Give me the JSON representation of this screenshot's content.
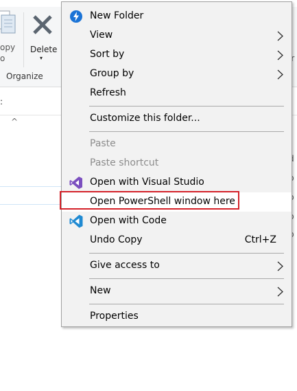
{
  "ribbon": {
    "copy_label_top": "opy",
    "copy_label_bottom": "o",
    "delete_label": "Delete",
    "delete_caret": "▾",
    "organize_label": "Organize"
  },
  "background": {
    "addr_glyph": ":",
    "sort_chevron": "^",
    "right_fragments": [
      "ir",
      "d",
      "p",
      "p",
      "p",
      "p"
    ]
  },
  "menu": {
    "new_folder": "New Folder",
    "view": "View",
    "sort_by": "Sort by",
    "group_by": "Group by",
    "refresh": "Refresh",
    "customize": "Customize this folder...",
    "paste": "Paste",
    "paste_shortcut": "Paste shortcut",
    "open_vs": "Open with Visual Studio",
    "open_powershell": "Open PowerShell window here",
    "open_code": "Open with Code",
    "undo_copy": "Undo Copy",
    "undo_copy_shortcut": "Ctrl+Z",
    "give_access": "Give access to",
    "new": "New",
    "properties": "Properties"
  },
  "colors": {
    "highlight_border": "#d42128",
    "new_folder_icon": "#1a73d6",
    "vs_purple": "#7b4fbf",
    "vscode_blue": "#1f8ad2"
  },
  "icons": {
    "new_folder": "new-folder-icon",
    "visual_studio": "visual-studio-icon",
    "vscode": "vscode-icon",
    "submenu": "chevron-right-icon"
  }
}
